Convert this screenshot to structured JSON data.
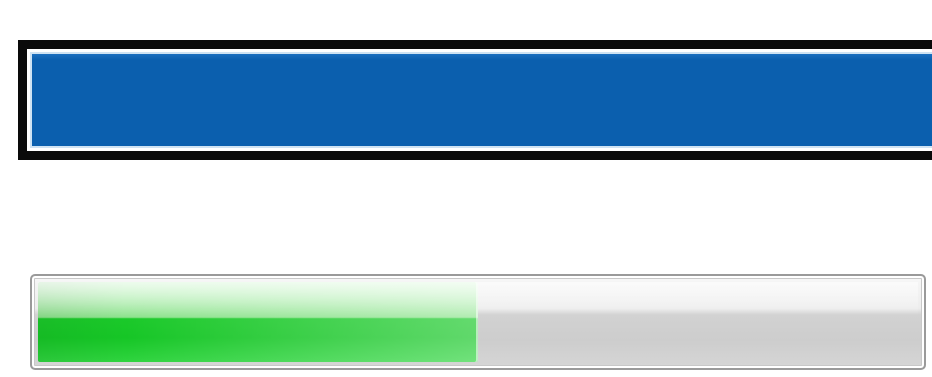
{
  "top_bar": {
    "state": "selected",
    "fill_color": "#0b5fae",
    "border_color": "#0a0a0a"
  },
  "progress": {
    "value_percent": 50,
    "fill_color": "#16c626",
    "track_color": "#cdcdcd"
  }
}
